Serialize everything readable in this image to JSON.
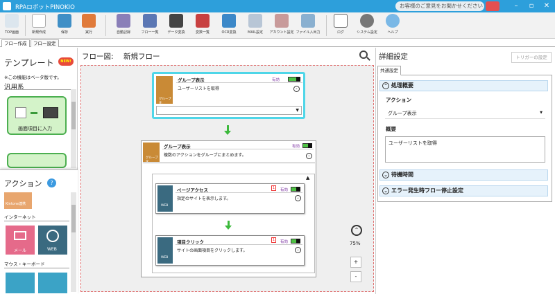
{
  "window": {
    "title": "RPAロボットPINOKIO",
    "feedback": "お客様のご意見をお聞かせください",
    "min": "–",
    "max": "▫",
    "close": "✕"
  },
  "toolbar": [
    {
      "label": "TOP画面",
      "icon": "top-screen-icon"
    },
    {
      "label": "新規作成",
      "icon": "new-doc-icon"
    },
    {
      "label": "保存",
      "icon": "save-icon"
    },
    {
      "label": "実行",
      "icon": "run-icon"
    },
    {
      "label": "自動記録",
      "icon": "film-icon"
    },
    {
      "label": "フロー一覧",
      "icon": "list-icon"
    },
    {
      "label": "データ変換",
      "icon": "gears-icon"
    },
    {
      "label": "変数一覧",
      "icon": "variables-icon"
    },
    {
      "label": "OCR変換",
      "icon": "ocr-icon"
    },
    {
      "label": "MAIL設定",
      "icon": "mail-icon"
    },
    {
      "label": "アカウント設定",
      "icon": "account-icon"
    },
    {
      "label": "ファイル入出力",
      "icon": "file-io-icon"
    },
    {
      "label": "ログ",
      "icon": "log-icon"
    },
    {
      "label": "システム設定",
      "icon": "system-gear-icon"
    },
    {
      "label": "ヘルプ",
      "icon": "help-icon"
    }
  ],
  "tabs": [
    "フロー作成",
    "フロー設定"
  ],
  "left": {
    "template_title": "テンプレート",
    "new_badge": "NEW!",
    "beta_note": "※この機能はベータ版です。",
    "category": "汎用系",
    "template_card": {
      "label": "画面項目に入力",
      "icon_left": "マウス操作",
      "icon_right": "キー操作"
    },
    "action_title": "アクション",
    "kintone_label": "Kintone連携",
    "internet_label": "インターネット",
    "mail_label": "メール",
    "web_label": "WEB",
    "mouse_keyboard_label": "マウス・キーボード"
  },
  "flow": {
    "header_label": "フロー図:",
    "name": "新規フロー",
    "top_node": {
      "title": "グループ表示",
      "status": "有効",
      "desc": "ユーザーリストを取得",
      "icon_label": "グループ化"
    },
    "group_node": {
      "title": "グループ表示",
      "status": "有効",
      "desc": "複数のアクションをグループにまとめます。",
      "icon_label": "グループ化"
    },
    "inner_nodes": [
      {
        "title": "ページアクセス",
        "status": "有効",
        "badge": "1",
        "desc": "指定のサイトを表示します。",
        "icon_label": "WEB"
      },
      {
        "title": "項目クリック",
        "status": "有効",
        "badge": "1",
        "desc": "サイトの画面項目をクリックします。",
        "icon_label": "WEB"
      }
    ],
    "zoom": "75%",
    "zoom_in": "+",
    "zoom_out": "-"
  },
  "details": {
    "title": "詳細設定",
    "trigger_button": "トリガーの設定",
    "tab": "共通設定",
    "section1": "処理概要",
    "action_label": "アクション",
    "action_value": "グループ表示",
    "summary_label": "概要",
    "summary_value": "ユーザーリストを取得",
    "section2": "待機時間",
    "section3": "エラー発生時フロー停止設定"
  },
  "colors": {
    "accent": "#2d9fdb",
    "flow_arrow": "#3cb93c",
    "highlight": "#4fd6e8"
  }
}
